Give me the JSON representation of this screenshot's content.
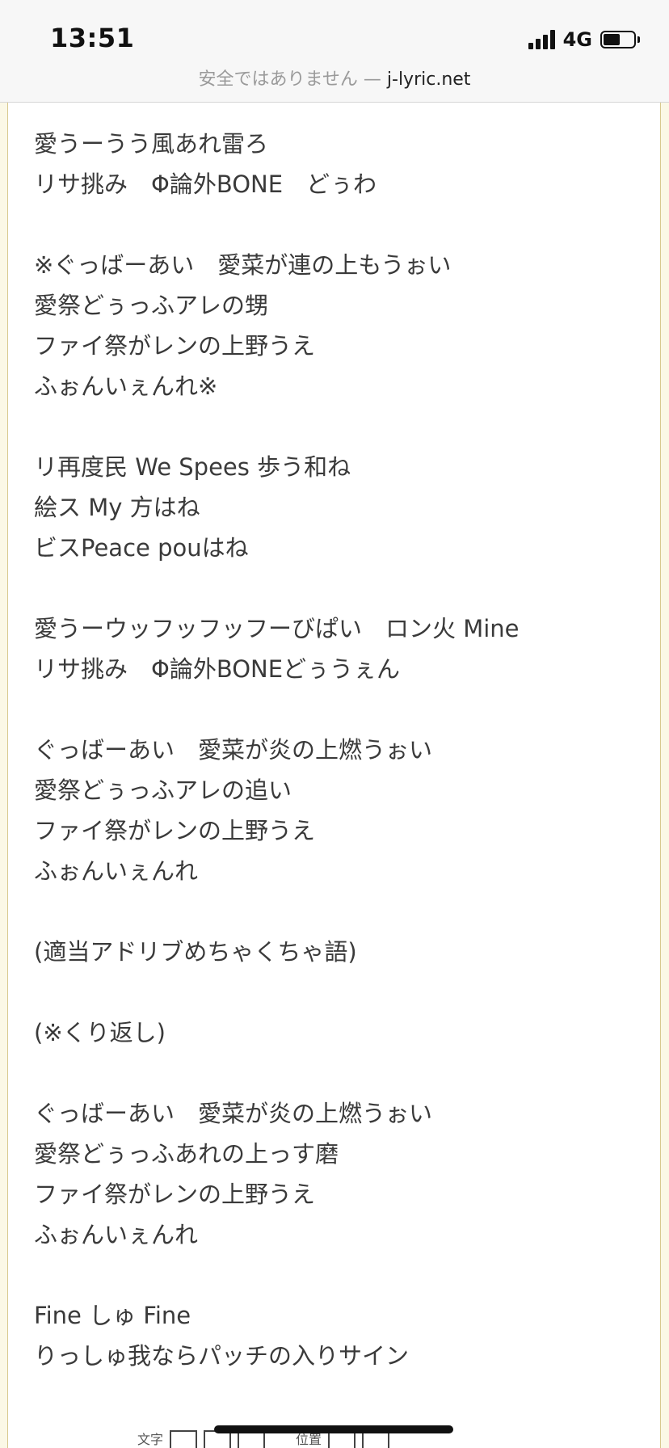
{
  "status_bar": {
    "time": "13:51",
    "network": "4G"
  },
  "url_bar": {
    "warning": "安全ではありません —",
    "domain": "j-lyric.net"
  },
  "lyrics": [
    "愛うーうう風あれ雷ろ",
    "リサ挑み　Φ論外BONE　どぅわ",
    "",
    "※ぐっばーあい　愛菜が連の上もうぉい",
    "愛祭どぅっふアレの甥",
    "ファイ祭がレンの上野うえ",
    "ふぉんいぇんれ※",
    "",
    "リ再度民 We Spees 歩う和ね",
    "絵ス My 方はね",
    "ビスPeace pouはね",
    "",
    "愛うーウッフッフッフーびぱい　ロン火 Mine",
    "リサ挑み　Φ論外BONEどぅうぇん",
    "",
    "ぐっばーあい　愛菜が炎の上燃うぉい",
    "愛祭どぅっふアレの追い",
    "ファイ祭がレンの上野うえ",
    "ふぉんいぇんれ",
    "",
    "(適当アドリブめちゃくちゃ語)",
    "",
    "(※くり返し)",
    "",
    "ぐっばーあい　愛菜が炎の上燃うぉい",
    "愛祭どぅっふあれの上っす磨",
    "ファイ祭がレンの上野うえ",
    "ふぉんいぇんれ",
    "",
    "Fine しゅ Fine",
    "りっしゅ我ならパッチの入りサイン"
  ],
  "footer": {
    "label_left": "文字",
    "label_right": "位置"
  }
}
